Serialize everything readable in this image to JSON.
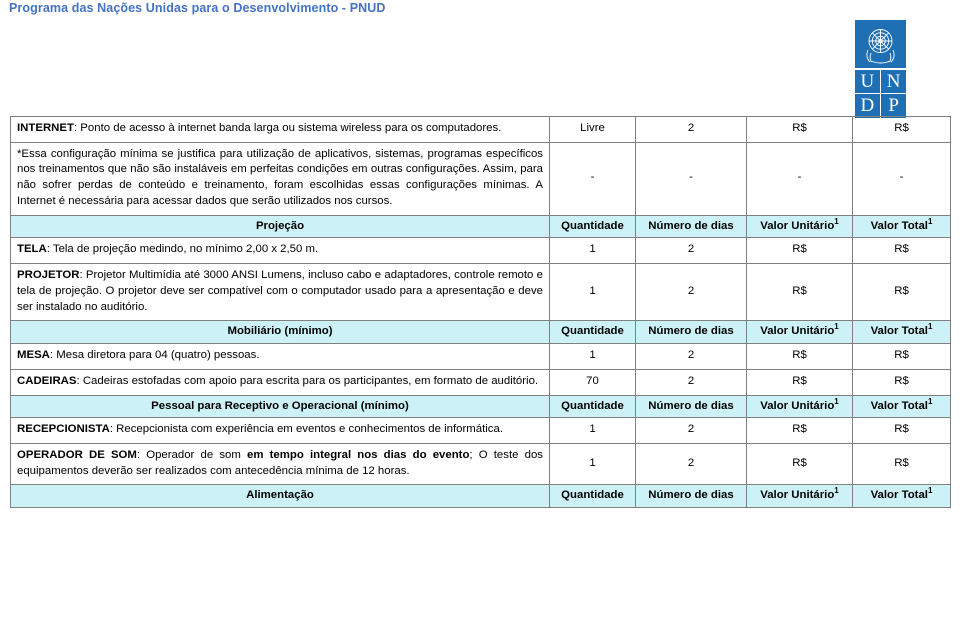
{
  "document": {
    "header_title": "Programa das Nações Unidas para o Desenvolvimento - PNUD",
    "header_color": "#4472C4",
    "logo": {
      "name": "undp-logo",
      "letters": [
        "U",
        "N",
        "D",
        "P"
      ],
      "brand_color": "#1F6FB5"
    }
  },
  "table": {
    "header_bg": "#CCF2F7",
    "column_headers": {
      "quantidade": "Quantidade",
      "numero_de_dias": "Número de dias",
      "valor_unitario": "Valor Unitário",
      "valor_total": "Valor Total",
      "superscript": "1"
    },
    "sections": [
      {
        "section_title": null,
        "rows": [
          {
            "label": "INTERNET",
            "description": ": Ponto de acesso à internet banda larga ou sistema wireless para os computadores.",
            "quantidade": "Livre",
            "numero_de_dias": "2",
            "valor_unitario": "R$",
            "valor_total": "R$"
          },
          {
            "label": "",
            "description": "*Essa configuração mínima se justifica para utilização de aplicativos, sistemas, programas específicos nos treinamentos que não são instaláveis em perfeitas condições em outras configurações. Assim, para não sofrer perdas de conteúdo e treinamento, foram escolhidas essas configurações mínimas. A Internet é necessária para acessar dados que serão utilizados nos cursos.",
            "quantidade": "-",
            "numero_de_dias": "-",
            "valor_unitario": "-",
            "valor_total": "-"
          }
        ]
      },
      {
        "section_title": "Projeção",
        "rows": [
          {
            "label": "TELA",
            "description": ": Tela de projeção medindo, no mínimo 2,00 x 2,50 m.",
            "quantidade": "1",
            "numero_de_dias": "2",
            "valor_unitario": "R$",
            "valor_total": "R$"
          },
          {
            "label": "PROJETOR",
            "description": ": Projetor Multimídia até 3000 ANSI Lumens, incluso cabo e adaptadores, controle remoto e tela de projeção. O projetor deve ser compatível com o computador usado para a apresentação e deve ser instalado no auditório.",
            "quantidade": "1",
            "numero_de_dias": "2",
            "valor_unitario": "R$",
            "valor_total": "R$"
          }
        ]
      },
      {
        "section_title": "Mobiliário (mínimo)",
        "rows": [
          {
            "label": "MESA",
            "description": ": Mesa diretora para 04 (quatro) pessoas.",
            "quantidade": "1",
            "numero_de_dias": "2",
            "valor_unitario": "R$",
            "valor_total": "R$"
          },
          {
            "label": "CADEIRAS",
            "description": ": Cadeiras estofadas com apoio para escrita para os participantes, em formato de auditório.",
            "quantidade": "70",
            "numero_de_dias": "2",
            "valor_unitario": "R$",
            "valor_total": "R$"
          }
        ]
      },
      {
        "section_title": "Pessoal para Receptivo e Operacional (mínimo)",
        "rows": [
          {
            "label": "RECEPCIONISTA",
            "description": ": Recepcionista com experiência em eventos e conhecimentos de informática.",
            "quantidade": "1",
            "numero_de_dias": "2",
            "valor_unitario": "R$",
            "valor_total": "R$"
          },
          {
            "label": "OPERADOR DE SOM",
            "description_part1": ": Operador de som ",
            "description_bold": "em tempo integral nos dias do evento",
            "description_part2": "; O teste dos equipamentos deverão ser realizados com antecedência mínima de 12 horas.",
            "quantidade": "1",
            "numero_de_dias": "2",
            "valor_unitario": "R$",
            "valor_total": "R$"
          }
        ]
      },
      {
        "section_title": "Alimentação",
        "rows": []
      }
    ]
  }
}
